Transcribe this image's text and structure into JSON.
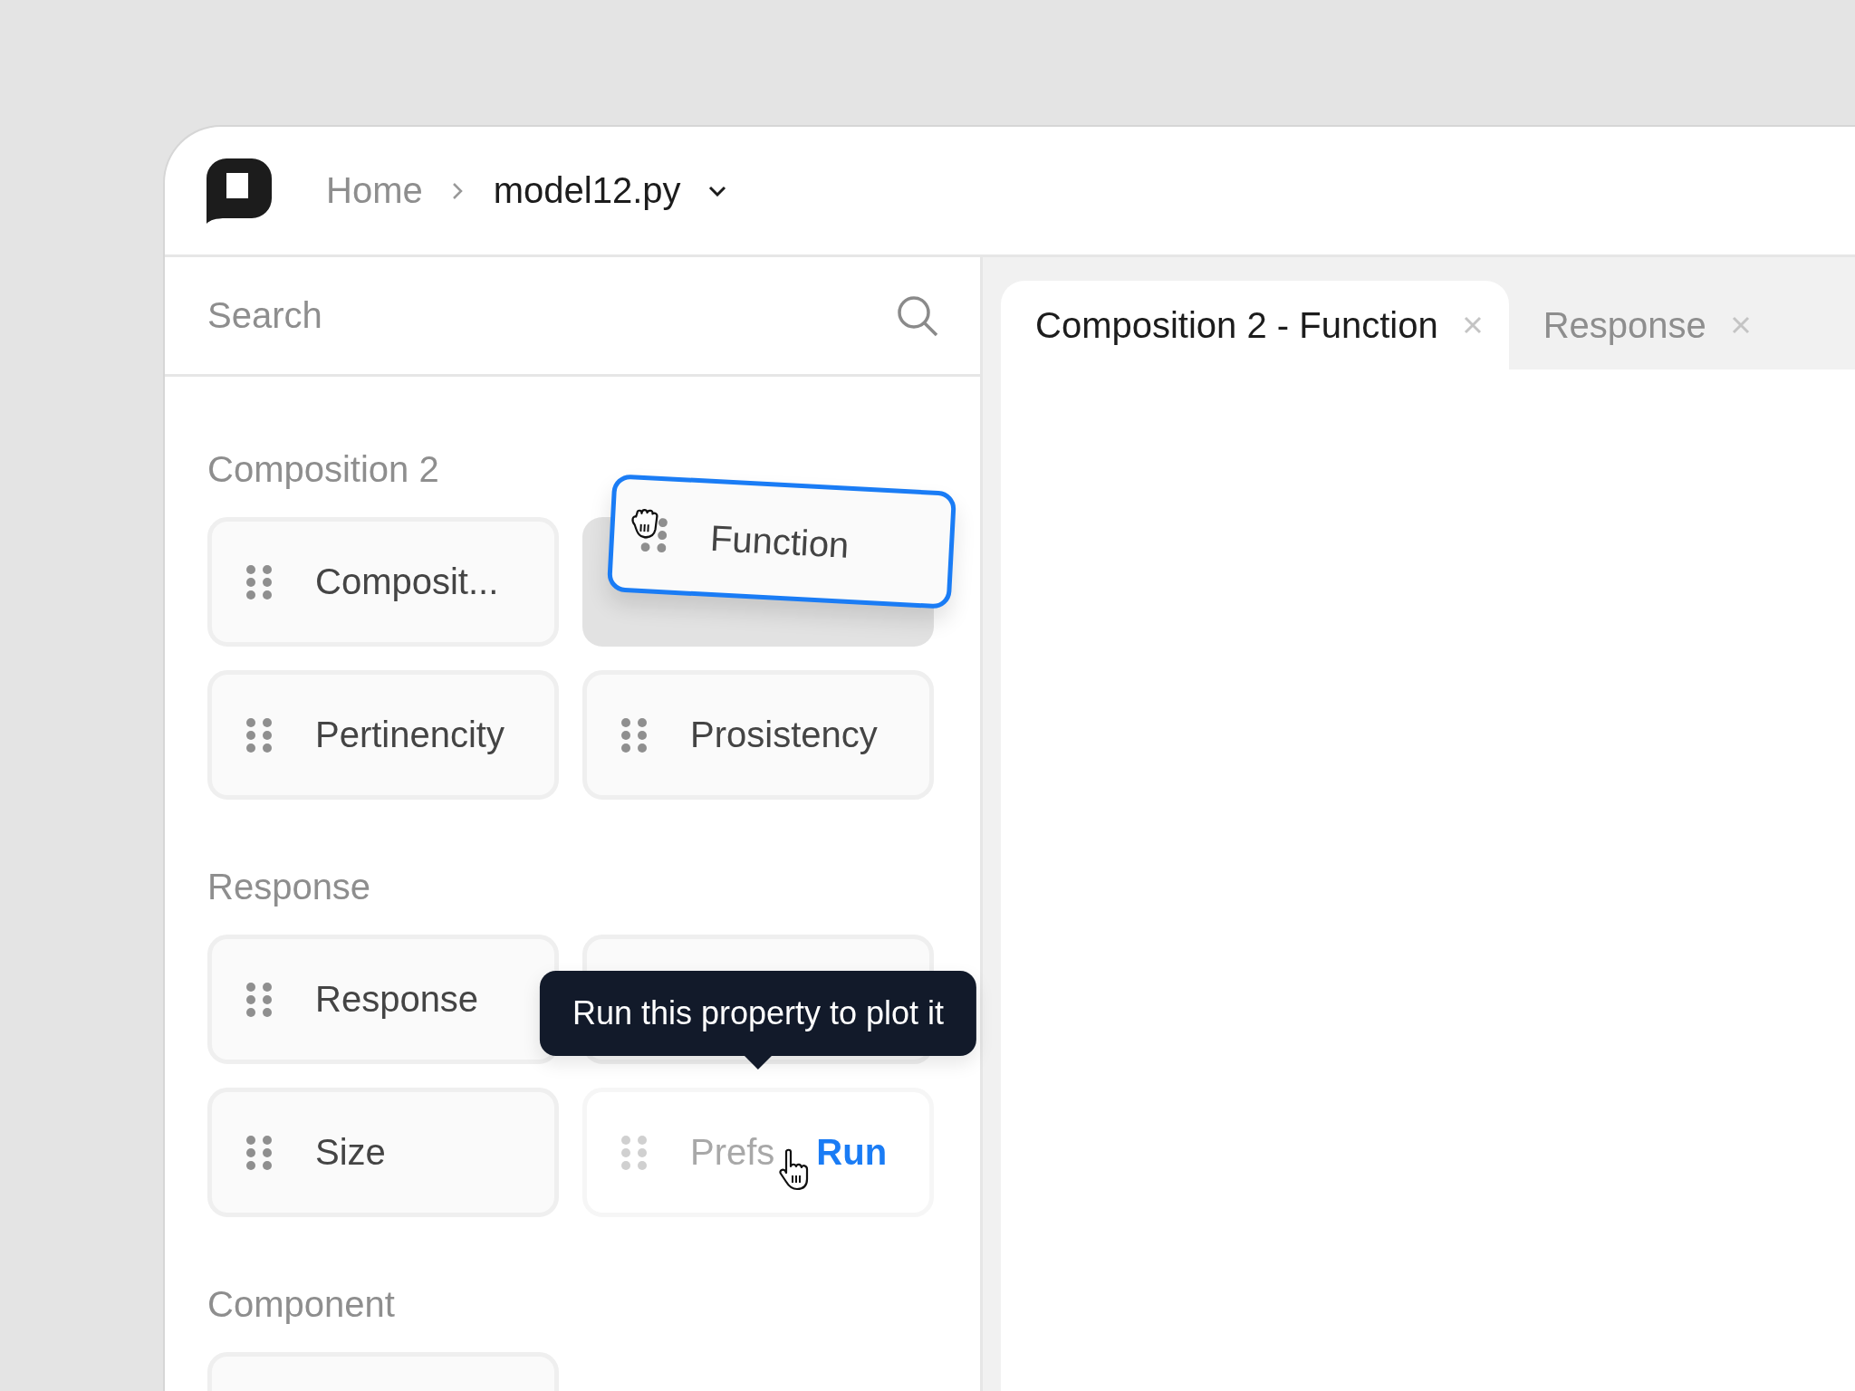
{
  "breadcrumb": {
    "home": "Home",
    "file": "model12.py"
  },
  "search": {
    "placeholder": "Search"
  },
  "sections": [
    {
      "title": "Composition 2",
      "items": [
        {
          "kind": "item",
          "label": "Composit..."
        },
        {
          "kind": "dragging",
          "label": "Function"
        },
        {
          "kind": "item",
          "label": "Pertinencity"
        },
        {
          "kind": "item",
          "label": "Prosistency"
        }
      ]
    },
    {
      "title": "Response",
      "items": [
        {
          "kind": "item",
          "label": "Response"
        },
        {
          "kind": "empty"
        },
        {
          "kind": "item",
          "label": "Size"
        },
        {
          "kind": "run",
          "label": "Prefs",
          "action": "Run",
          "disabled": true,
          "tooltip": "Run this property to plot it"
        }
      ]
    },
    {
      "title": "Component",
      "items": [
        {
          "kind": "empty"
        }
      ]
    }
  ],
  "tabs": [
    {
      "label": "Composition 2 - Function",
      "selected": true
    },
    {
      "label": "Response",
      "selected": false
    }
  ]
}
